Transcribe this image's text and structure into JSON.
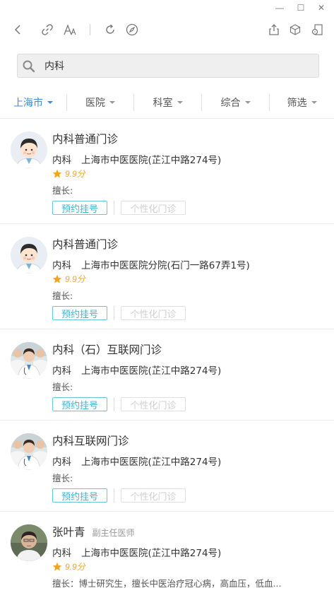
{
  "window": {
    "minimize": "—",
    "maximize": "☐",
    "close": "✕"
  },
  "search": {
    "value": "内科",
    "placeholder": ""
  },
  "filters": [
    {
      "label": "上海市",
      "active": true
    },
    {
      "label": "医院",
      "active": false
    },
    {
      "label": "科室",
      "active": false
    },
    {
      "label": "综合",
      "active": false
    },
    {
      "label": "筛选",
      "active": false
    }
  ],
  "colors": {
    "accent": "#3a8de0",
    "book_button": "#3db5d2",
    "star": "#f0a623"
  },
  "items": [
    {
      "title": "内科普通门诊",
      "title_extra": "",
      "dept": "内科",
      "hospital": "上海市中医医院(芷江中路274号)",
      "rating": "9.9分",
      "skill": "擅长:",
      "book_label": "预约挂号",
      "personal_label": "个性化门诊",
      "avatar": "cartoon-doctor"
    },
    {
      "title": "内科普通门诊",
      "title_extra": "",
      "dept": "内科",
      "hospital": "上海市中医医院分院(石门一路67弄1号)",
      "rating": "9.9分",
      "skill": "擅长:",
      "book_label": "预约挂号",
      "personal_label": "个性化门诊",
      "avatar": "cartoon-doctor"
    },
    {
      "title": "内科（石）互联网门诊",
      "title_extra": "",
      "dept": "内科",
      "hospital": "上海市中医医院(芷江中路274号)",
      "rating": "",
      "skill": "擅长:",
      "book_label": "预约挂号",
      "personal_label": "个性化门诊",
      "avatar": "doctor-group-photo"
    },
    {
      "title": "内科互联网门诊",
      "title_extra": "",
      "dept": "内科",
      "hospital": "上海市中医医院(芷江中路274号)",
      "rating": "",
      "skill": "擅长:",
      "book_label": "预约挂号",
      "personal_label": "个性化门诊",
      "avatar": "doctor-group-photo"
    },
    {
      "title": "张叶青",
      "title_extra": "副主任医师",
      "dept": "内科",
      "hospital": "上海市中医医院(芷江中路274号)",
      "rating": "9.9分",
      "skill": "擅长：博士研究生，擅长中医治疗冠心病，高血压，低血...",
      "book_label": "",
      "personal_label": "",
      "avatar": "doctor-portrait-photo"
    }
  ]
}
